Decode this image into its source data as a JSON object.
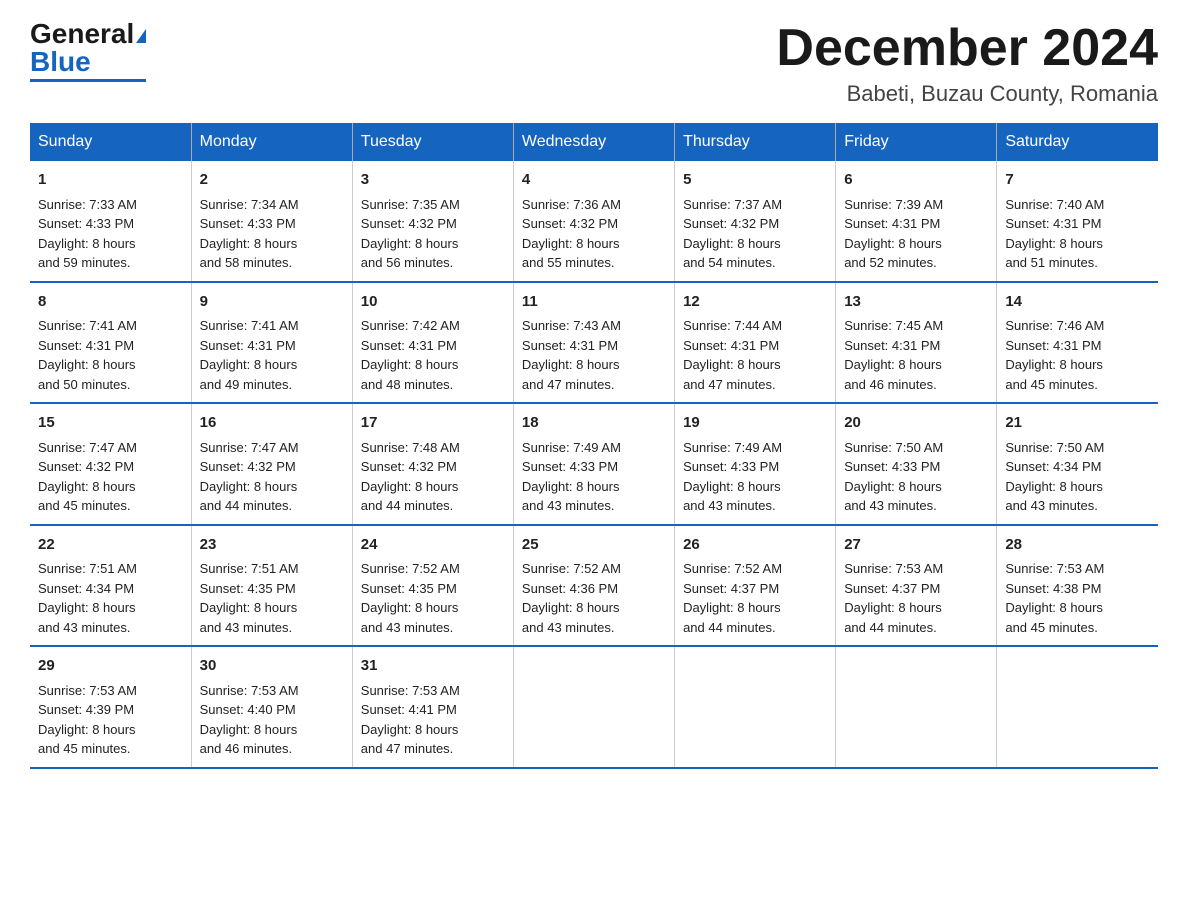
{
  "header": {
    "logo_general": "General",
    "logo_blue": "Blue",
    "month_title": "December 2024",
    "location": "Babeti, Buzau County, Romania"
  },
  "weekdays": [
    "Sunday",
    "Monday",
    "Tuesday",
    "Wednesday",
    "Thursday",
    "Friday",
    "Saturday"
  ],
  "weeks": [
    [
      {
        "day": "1",
        "sunrise": "7:33 AM",
        "sunset": "4:33 PM",
        "daylight": "8 hours and 59 minutes."
      },
      {
        "day": "2",
        "sunrise": "7:34 AM",
        "sunset": "4:33 PM",
        "daylight": "8 hours and 58 minutes."
      },
      {
        "day": "3",
        "sunrise": "7:35 AM",
        "sunset": "4:32 PM",
        "daylight": "8 hours and 56 minutes."
      },
      {
        "day": "4",
        "sunrise": "7:36 AM",
        "sunset": "4:32 PM",
        "daylight": "8 hours and 55 minutes."
      },
      {
        "day": "5",
        "sunrise": "7:37 AM",
        "sunset": "4:32 PM",
        "daylight": "8 hours and 54 minutes."
      },
      {
        "day": "6",
        "sunrise": "7:39 AM",
        "sunset": "4:31 PM",
        "daylight": "8 hours and 52 minutes."
      },
      {
        "day": "7",
        "sunrise": "7:40 AM",
        "sunset": "4:31 PM",
        "daylight": "8 hours and 51 minutes."
      }
    ],
    [
      {
        "day": "8",
        "sunrise": "7:41 AM",
        "sunset": "4:31 PM",
        "daylight": "8 hours and 50 minutes."
      },
      {
        "day": "9",
        "sunrise": "7:41 AM",
        "sunset": "4:31 PM",
        "daylight": "8 hours and 49 minutes."
      },
      {
        "day": "10",
        "sunrise": "7:42 AM",
        "sunset": "4:31 PM",
        "daylight": "8 hours and 48 minutes."
      },
      {
        "day": "11",
        "sunrise": "7:43 AM",
        "sunset": "4:31 PM",
        "daylight": "8 hours and 47 minutes."
      },
      {
        "day": "12",
        "sunrise": "7:44 AM",
        "sunset": "4:31 PM",
        "daylight": "8 hours and 47 minutes."
      },
      {
        "day": "13",
        "sunrise": "7:45 AM",
        "sunset": "4:31 PM",
        "daylight": "8 hours and 46 minutes."
      },
      {
        "day": "14",
        "sunrise": "7:46 AM",
        "sunset": "4:31 PM",
        "daylight": "8 hours and 45 minutes."
      }
    ],
    [
      {
        "day": "15",
        "sunrise": "7:47 AM",
        "sunset": "4:32 PM",
        "daylight": "8 hours and 45 minutes."
      },
      {
        "day": "16",
        "sunrise": "7:47 AM",
        "sunset": "4:32 PM",
        "daylight": "8 hours and 44 minutes."
      },
      {
        "day": "17",
        "sunrise": "7:48 AM",
        "sunset": "4:32 PM",
        "daylight": "8 hours and 44 minutes."
      },
      {
        "day": "18",
        "sunrise": "7:49 AM",
        "sunset": "4:33 PM",
        "daylight": "8 hours and 43 minutes."
      },
      {
        "day": "19",
        "sunrise": "7:49 AM",
        "sunset": "4:33 PM",
        "daylight": "8 hours and 43 minutes."
      },
      {
        "day": "20",
        "sunrise": "7:50 AM",
        "sunset": "4:33 PM",
        "daylight": "8 hours and 43 minutes."
      },
      {
        "day": "21",
        "sunrise": "7:50 AM",
        "sunset": "4:34 PM",
        "daylight": "8 hours and 43 minutes."
      }
    ],
    [
      {
        "day": "22",
        "sunrise": "7:51 AM",
        "sunset": "4:34 PM",
        "daylight": "8 hours and 43 minutes."
      },
      {
        "day": "23",
        "sunrise": "7:51 AM",
        "sunset": "4:35 PM",
        "daylight": "8 hours and 43 minutes."
      },
      {
        "day": "24",
        "sunrise": "7:52 AM",
        "sunset": "4:35 PM",
        "daylight": "8 hours and 43 minutes."
      },
      {
        "day": "25",
        "sunrise": "7:52 AM",
        "sunset": "4:36 PM",
        "daylight": "8 hours and 43 minutes."
      },
      {
        "day": "26",
        "sunrise": "7:52 AM",
        "sunset": "4:37 PM",
        "daylight": "8 hours and 44 minutes."
      },
      {
        "day": "27",
        "sunrise": "7:53 AM",
        "sunset": "4:37 PM",
        "daylight": "8 hours and 44 minutes."
      },
      {
        "day": "28",
        "sunrise": "7:53 AM",
        "sunset": "4:38 PM",
        "daylight": "8 hours and 45 minutes."
      }
    ],
    [
      {
        "day": "29",
        "sunrise": "7:53 AM",
        "sunset": "4:39 PM",
        "daylight": "8 hours and 45 minutes."
      },
      {
        "day": "30",
        "sunrise": "7:53 AM",
        "sunset": "4:40 PM",
        "daylight": "8 hours and 46 minutes."
      },
      {
        "day": "31",
        "sunrise": "7:53 AM",
        "sunset": "4:41 PM",
        "daylight": "8 hours and 47 minutes."
      },
      null,
      null,
      null,
      null
    ]
  ]
}
